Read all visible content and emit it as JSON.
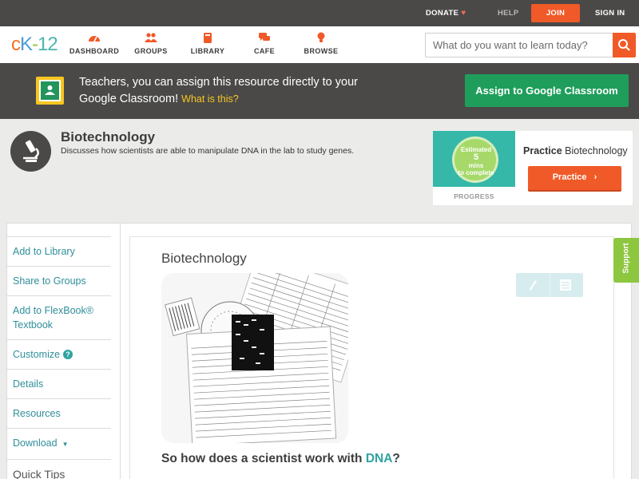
{
  "topbar": {
    "donate": "DONATE",
    "heart": "♥",
    "help": "HELP",
    "join": "JOIN",
    "signin": "SIGN IN"
  },
  "header": {
    "logo": {
      "c": "c",
      "k": "K",
      "dash": "-",
      "n": "12"
    },
    "nav": [
      {
        "label": "DASHBOARD",
        "icon": "dashboard-icon"
      },
      {
        "label": "GROUPS",
        "icon": "groups-icon"
      },
      {
        "label": "LIBRARY",
        "icon": "library-icon"
      },
      {
        "label": "CAFE",
        "icon": "cafe-icon"
      },
      {
        "label": "BROWSE",
        "icon": "browse-icon"
      }
    ],
    "search_placeholder": "What do you want to learn today?"
  },
  "banner": {
    "text": "Teachers, you can assign this resource directly to your Google Classroom!",
    "link": "What is this?",
    "button": "Assign to Google Classroom"
  },
  "concept": {
    "title": "Biotechnology",
    "description": "Discusses how scientists are able to manipulate DNA in the lab to study genes."
  },
  "practice": {
    "estimate_line1": "Estimated",
    "estimate_line2": "5",
    "estimate_line3": "mins",
    "estimate_line4": "to complete",
    "progress_label": "PROGRESS",
    "title_prefix": "Practice",
    "title_topic": "Biotechnology",
    "button": "Practice"
  },
  "sidebar": {
    "items": [
      {
        "label": "Add to Library"
      },
      {
        "label": "Share to Groups"
      },
      {
        "label": "Add to FlexBook® Textbook"
      },
      {
        "label": "Customize"
      },
      {
        "label": "Details"
      },
      {
        "label": "Resources"
      },
      {
        "label": "Download"
      },
      {
        "label": "Quick Tips"
      }
    ]
  },
  "main": {
    "title": "Biotechnology",
    "question_prefix": "So how does a scientist work with",
    "question_term": "DNA",
    "question_suffix": "?"
  },
  "support": "Support",
  "colors": {
    "accent_orange": "#f05a28",
    "google_green": "#1f9e5b",
    "teal_link": "#2f8f9b",
    "support_green": "#8dc63f"
  }
}
